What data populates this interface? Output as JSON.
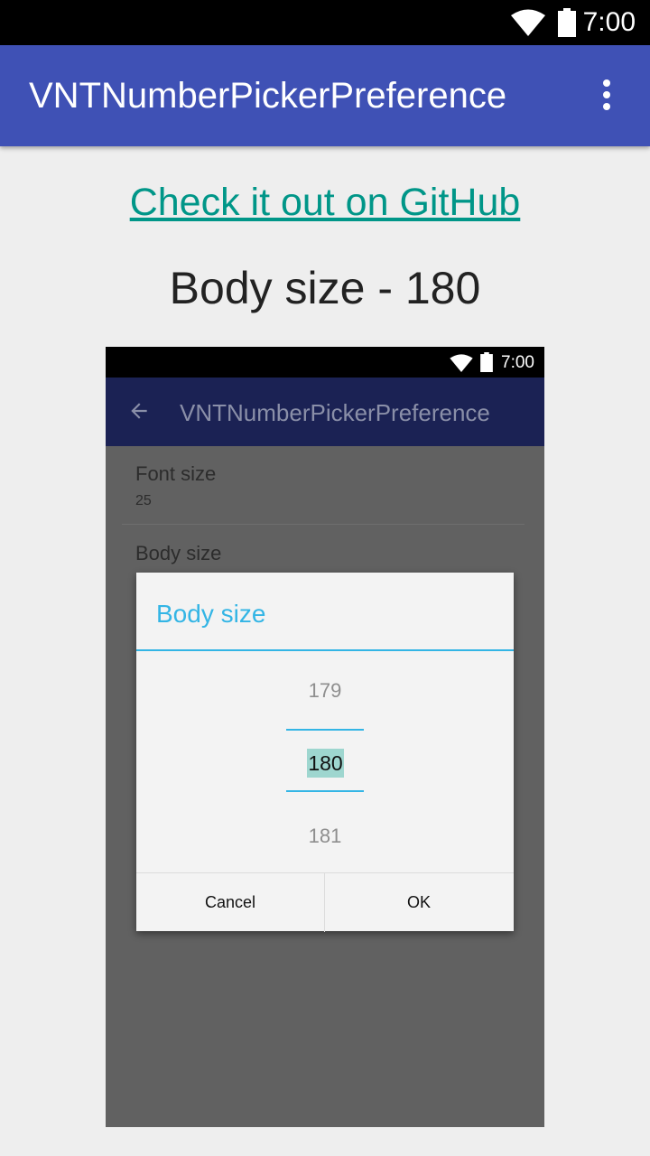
{
  "status_bar": {
    "time": "7:00",
    "icons": [
      "wifi-icon",
      "battery-icon"
    ]
  },
  "app_bar": {
    "title": "VNTNumberPickerPreference",
    "overflow_icon": "more-vert-icon"
  },
  "main": {
    "github_link": "Check it out on GitHub",
    "body_size_heading": "Body size - 180"
  },
  "screenshot": {
    "status_bar": {
      "time": "7:00"
    },
    "app_bar": {
      "title": "VNTNumberPickerPreference",
      "back_icon": "arrow-back-icon"
    },
    "preferences": [
      {
        "title": "Font size",
        "summary": "25"
      },
      {
        "title": "Body size"
      }
    ],
    "dialog": {
      "title": "Body size",
      "picker": {
        "previous": "179",
        "current": "180",
        "next": "181"
      },
      "cancel_label": "Cancel",
      "ok_label": "OK"
    }
  },
  "colors": {
    "primary": "#3f51b5",
    "link": "#009688",
    "dialog_accent": "#33b5e5",
    "selection_highlight": "#9ed6cf"
  }
}
